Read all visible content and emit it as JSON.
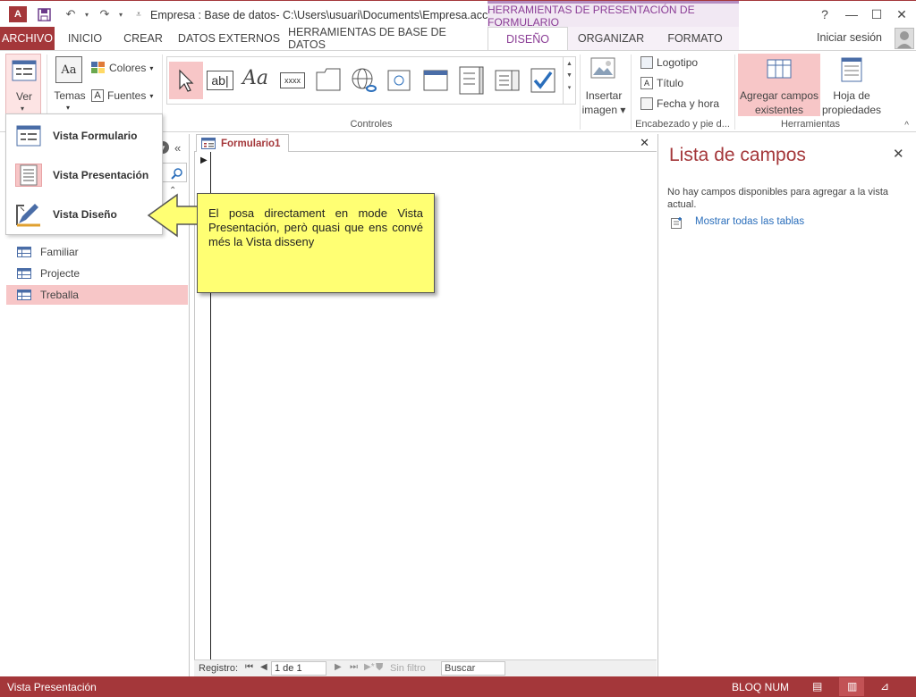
{
  "app": {
    "logo_text": "A",
    "title": "Empresa : Base de datos- C:\\Users\\usuari\\Documents\\Empresa.acc...",
    "context_header": "HERRAMIENTAS DE PRESENTACIÓN DE FORMULARIO",
    "help": "?",
    "signin": "Iniciar sesión"
  },
  "tabs": [
    {
      "label": "ARCHIVO"
    },
    {
      "label": "INICIO"
    },
    {
      "label": "CREAR"
    },
    {
      "label": "DATOS EXTERNOS"
    },
    {
      "label": "HERRAMIENTAS DE BASE DE DATOS"
    },
    {
      "label": "DISEÑO"
    },
    {
      "label": "ORGANIZAR"
    },
    {
      "label": "FORMATO"
    }
  ],
  "ribbon": {
    "ver": "Ver",
    "temas": "Temas",
    "colores": "Colores",
    "fuentes": "Fuentes",
    "controles_group": "Controles",
    "insertar_imagen_1": "Insertar",
    "insertar_imagen_2": "imagen",
    "logotipo": "Logotipo",
    "titulo": "Título",
    "fecha_hora": "Fecha y hora",
    "encabezado_group": "Encabezado y pie d...",
    "agregar_campos_1": "Agregar campos",
    "agregar_campos_2": "existentes",
    "hoja_prop_1": "Hoja de",
    "hoja_prop_2": "propiedades",
    "herramientas_group": "Herramientas"
  },
  "view_menu": {
    "items": [
      {
        "label": "Vista Formulario"
      },
      {
        "label": "Vista Presentación"
      },
      {
        "label": "Vista Diseño"
      }
    ]
  },
  "nav": {
    "items": [
      {
        "label": "Familiar"
      },
      {
        "label": "Projecte"
      },
      {
        "label": "Treballa"
      }
    ]
  },
  "document": {
    "tab_label": "Formulario1"
  },
  "record_nav": {
    "label": "Registro:",
    "position": "1 de 1",
    "filter": "Sin filtro",
    "search": "Buscar"
  },
  "field_list": {
    "title": "Lista de campos",
    "message": "No hay campos disponibles para agregar a la vista actual.",
    "show_all": "Mostrar todas las tablas"
  },
  "callout": {
    "text": "El posa directament en mode Vista Presentación, però quasi que ens convé més la Vista disseny"
  },
  "status": {
    "left": "Vista Presentación",
    "bloq_num": "BLOQ NUM"
  },
  "colors": {
    "accent": "#a4373a",
    "context": "#8a3c95",
    "highlight": "#f7c6c7",
    "callout": "#ffff73"
  }
}
